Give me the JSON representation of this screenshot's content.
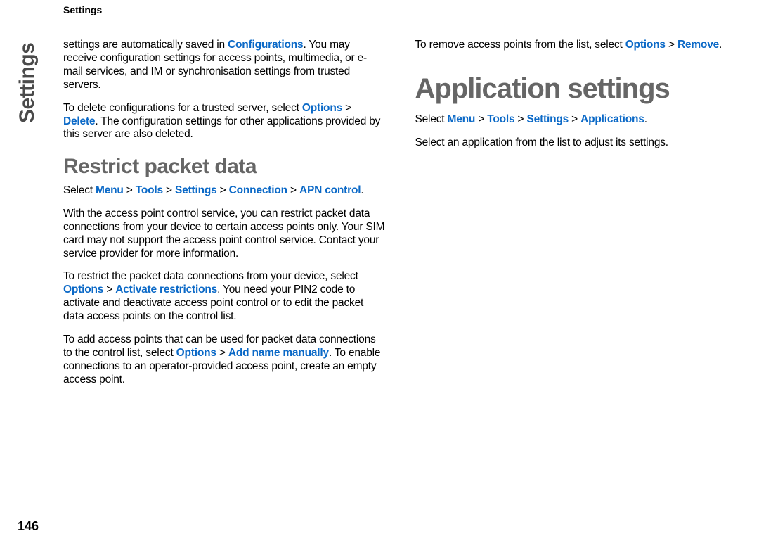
{
  "header": "Settings",
  "side_label": "Settings",
  "page_number": "146",
  "left": {
    "p1_a": "settings are automatically saved in ",
    "p1_link": "Configurations",
    "p1_b": ". You may receive configuration settings for access points, multimedia, or e-mail services, and IM or synchronisation settings from trusted servers.",
    "p2_a": "To delete configurations for a trusted server, select ",
    "p2_link1": "Options",
    "p2_gt": " > ",
    "p2_link2": "Delete",
    "p2_b": ". The configuration settings for other applications provided by this server are also deleted.",
    "h2": "Restrict packet data",
    "p3_a": "Select ",
    "p3_l1": "Menu",
    "p3_l2": "Tools",
    "p3_l3": "Settings",
    "p3_l4": "Connection",
    "p3_l5": "APN control",
    "p3_b": ".",
    "p4": "With the access point control service, you can restrict packet data connections from your device to certain access points only. Your SIM card may not support the access point control service. Contact your service provider for more information.",
    "p5_a": "To restrict the packet data connections from your device, select ",
    "p5_l1": "Options",
    "p5_l2": "Activate restrictions",
    "p5_b": ". You need your PIN2 code to activate and deactivate access point control or to edit the packet data access points on the control list.",
    "p6_a": "To add access points that can be used for packet data connections to the control list, select ",
    "p6_l1": "Options",
    "p6_l2": "Add name manually",
    "p6_b": ". To enable connections to an operator-provided access point, create an empty access point."
  },
  "right": {
    "p1_a": "To remove access points from the list, select ",
    "p1_l1": "Options",
    "p1_l2": "Remove",
    "p1_b": ".",
    "h1": "Application settings",
    "p2_a": "Select ",
    "p2_l1": "Menu",
    "p2_l2": "Tools",
    "p2_l3": "Settings",
    "p2_l4": "Applications",
    "p2_b": ".",
    "p3": "Select an application from the list to adjust its settings."
  },
  "gt": " > "
}
